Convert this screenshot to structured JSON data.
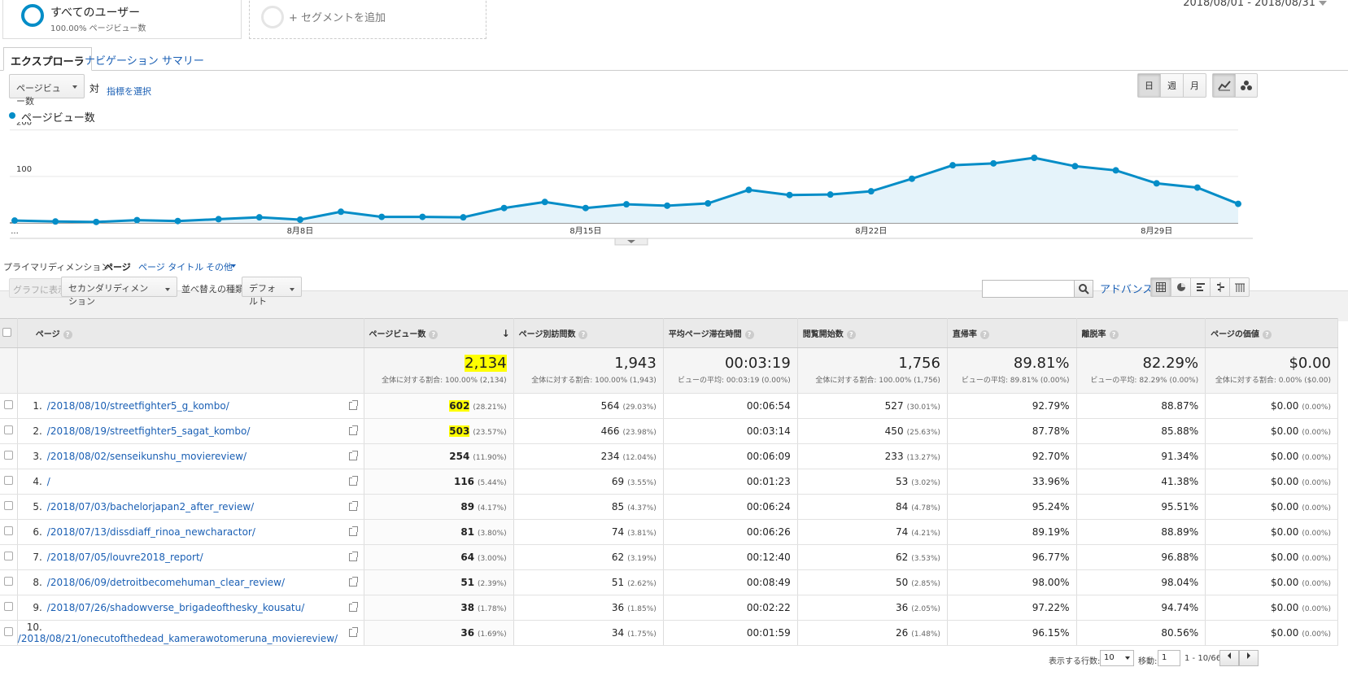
{
  "segments": {
    "all_users": {
      "name": "すべてのユーザー",
      "sub": "100.00% ページビュー数"
    },
    "add_segment": "+ セグメントを追加"
  },
  "date_range": "2018/08/01 - 2018/08/31",
  "tabs": {
    "explorer": "エクスプローラ",
    "navigation": "ナビゲーション サマリー"
  },
  "metric": {
    "selected": "ページビュー数",
    "vs": "対",
    "select_metric": "指標を選択"
  },
  "time_buttons": [
    "日",
    "週",
    "月"
  ],
  "legend": {
    "series": "ページビュー数",
    "color": "#058dc7"
  },
  "chart_data": {
    "type": "area",
    "series": [
      {
        "name": "ページビュー数",
        "values": [
          5,
          3,
          2,
          6,
          4,
          8,
          12,
          7,
          24,
          13,
          13,
          12,
          32,
          45,
          32,
          40,
          37,
          42,
          71,
          60,
          61,
          68,
          95,
          124,
          128,
          140,
          122,
          113,
          85,
          76,
          41
        ]
      }
    ],
    "x_ticks": [
      "...",
      "8月8日",
      "8月15日",
      "8月22日",
      "8月29日"
    ],
    "y_ticks": [
      100,
      200
    ],
    "ylim": [
      0,
      210
    ],
    "grid": true
  },
  "dimension": {
    "label": "プライマリディメンション:",
    "active": "ページ",
    "page_title": "ページ タイトル",
    "other": "その他"
  },
  "toolbar": {
    "plot": "グラフに表示",
    "secondary": "セカンダリディメンション",
    "sort_label": "並べ替えの種類:",
    "sort_value": "デフォルト",
    "advanced": "アドバンス"
  },
  "table": {
    "headers": [
      "ページ",
      "ページビュー数",
      "ページ別訪問数",
      "平均ページ滞在時間",
      "閲覧開始数",
      "直帰率",
      "離脱率",
      "ページの価値"
    ],
    "totals": [
      {
        "big": "2,134",
        "small": "全体に対する割合: 100.00% (2,134)"
      },
      {
        "big": "1,943",
        "small": "全体に対する割合: 100.00% (1,943)"
      },
      {
        "big": "00:03:19",
        "small": "ビューの平均: 00:03:19 (0.00%)"
      },
      {
        "big": "1,756",
        "small": "全体に対する割合: 100.00% (1,756)"
      },
      {
        "big": "89.81%",
        "small": "ビューの平均: 89.81% (0.00%)"
      },
      {
        "big": "82.29%",
        "small": "ビューの平均: 82.29% (0.00%)"
      },
      {
        "big": "$0.00",
        "small": "全体に対する割合: 0.00% ($0.00)"
      }
    ],
    "rows": [
      {
        "n": "1.",
        "page": "/2018/08/10/streetfighter5_g_kombo/",
        "pv": "602",
        "pvp": "(28.21%)",
        "up": "564",
        "upp": "(29.03%)",
        "time": "00:06:54",
        "ent": "527",
        "entp": "(30.01%)",
        "bounce": "92.79%",
        "exit": "88.87%",
        "val": "$0.00",
        "valp": "(0.00%)"
      },
      {
        "n": "2.",
        "page": "/2018/08/19/streetfighter5_sagat_kombo/",
        "pv": "503",
        "pvp": "(23.57%)",
        "up": "466",
        "upp": "(23.98%)",
        "time": "00:03:14",
        "ent": "450",
        "entp": "(25.63%)",
        "bounce": "87.78%",
        "exit": "85.88%",
        "val": "$0.00",
        "valp": "(0.00%)"
      },
      {
        "n": "3.",
        "page": "/2018/08/02/senseikunshu_moviereview/",
        "pv": "254",
        "pvp": "(11.90%)",
        "up": "234",
        "upp": "(12.04%)",
        "time": "00:06:09",
        "ent": "233",
        "entp": "(13.27%)",
        "bounce": "92.70%",
        "exit": "91.34%",
        "val": "$0.00",
        "valp": "(0.00%)"
      },
      {
        "n": "4.",
        "page": "/",
        "pv": "116",
        "pvp": "(5.44%)",
        "up": "69",
        "upp": "(3.55%)",
        "time": "00:01:23",
        "ent": "53",
        "entp": "(3.02%)",
        "bounce": "33.96%",
        "exit": "41.38%",
        "val": "$0.00",
        "valp": "(0.00%)"
      },
      {
        "n": "5.",
        "page": "/2018/07/03/bachelorjapan2_after_review/",
        "pv": "89",
        "pvp": "(4.17%)",
        "up": "85",
        "upp": "(4.37%)",
        "time": "00:06:24",
        "ent": "84",
        "entp": "(4.78%)",
        "bounce": "95.24%",
        "exit": "95.51%",
        "val": "$0.00",
        "valp": "(0.00%)"
      },
      {
        "n": "6.",
        "page": "/2018/07/13/dissdiaff_rinoa_newcharactor/",
        "pv": "81",
        "pvp": "(3.80%)",
        "up": "74",
        "upp": "(3.81%)",
        "time": "00:06:26",
        "ent": "74",
        "entp": "(4.21%)",
        "bounce": "89.19%",
        "exit": "88.89%",
        "val": "$0.00",
        "valp": "(0.00%)"
      },
      {
        "n": "7.",
        "page": "/2018/07/05/louvre2018_report/",
        "pv": "64",
        "pvp": "(3.00%)",
        "up": "62",
        "upp": "(3.19%)",
        "time": "00:12:40",
        "ent": "62",
        "entp": "(3.53%)",
        "bounce": "96.77%",
        "exit": "96.88%",
        "val": "$0.00",
        "valp": "(0.00%)"
      },
      {
        "n": "8.",
        "page": "/2018/06/09/detroitbecomehuman_clear_review/",
        "pv": "51",
        "pvp": "(2.39%)",
        "up": "51",
        "upp": "(2.62%)",
        "time": "00:08:49",
        "ent": "50",
        "entp": "(2.85%)",
        "bounce": "98.00%",
        "exit": "98.04%",
        "val": "$0.00",
        "valp": "(0.00%)"
      },
      {
        "n": "9.",
        "page": "/2018/07/26/shadowverse_brigadeofthesky_kousatu/",
        "pv": "38",
        "pvp": "(1.78%)",
        "up": "36",
        "upp": "(1.85%)",
        "time": "00:02:22",
        "ent": "36",
        "entp": "(2.05%)",
        "bounce": "97.22%",
        "exit": "94.74%",
        "val": "$0.00",
        "valp": "(0.00%)"
      },
      {
        "n": "10.",
        "page": "/2018/08/21/onecutofthedead_kamerawotomeruna_moviereview/",
        "pv": "36",
        "pvp": "(1.69%)",
        "up": "34",
        "upp": "(1.75%)",
        "time": "00:01:59",
        "ent": "26",
        "entp": "(1.48%)",
        "bounce": "96.15%",
        "exit": "80.56%",
        "val": "$0.00",
        "valp": "(0.00%)"
      }
    ]
  },
  "pagination": {
    "rows_label": "表示する行数:",
    "rows_value": "10",
    "goto_label": "移動:",
    "goto_value": "1",
    "range": "1 - 10/66"
  }
}
